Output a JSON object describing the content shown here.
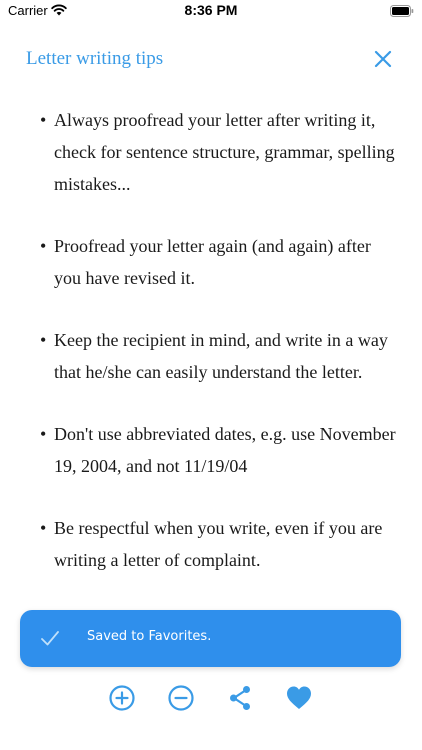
{
  "status_bar": {
    "carrier": "Carrier",
    "time": "8:36 PM"
  },
  "header": {
    "title": "Letter writing tips",
    "close_icon": "close-icon"
  },
  "tips": [
    {
      "bullet": "•",
      "text": " Always proofread your letter after writing it, check for sentence structure, grammar, spelling mistakes..."
    },
    {
      "bullet": "•",
      "text": "Proofread your letter again (and again) after you have revised it."
    },
    {
      "bullet": "•",
      "text": "Keep the recipient in mind, and write in a way that he/she can easily understand the letter."
    },
    {
      "bullet": "•",
      "text": "Don't use abbreviated dates, e.g. use November 19, 2004, and not 11/19/04"
    },
    {
      "bullet": "•",
      "text": "Be respectful when you write, even if you are writing a letter of complaint."
    }
  ],
  "toast": {
    "message": "Saved to Favorites.",
    "icon": "checkmark-icon"
  },
  "toolbar": {
    "icons": [
      "zoom-in-icon",
      "zoom-out-icon",
      "share-icon",
      "favorite-heart-icon"
    ]
  },
  "colors": {
    "accent": "#3a9be6",
    "toast_background": "#2f8fec",
    "text": "#1a1a1a"
  }
}
